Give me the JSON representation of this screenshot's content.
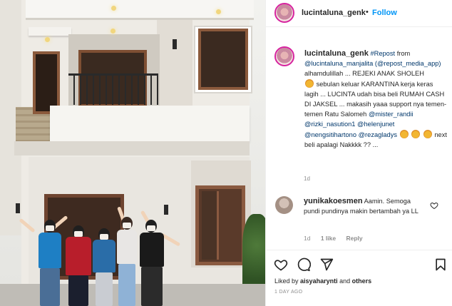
{
  "header": {
    "username": "lucintaluna_genk",
    "separator": "•",
    "follow_label": "Follow"
  },
  "caption": {
    "username": "lucintaluna_genk",
    "repost_tag": "#Repost",
    "from": "from",
    "source_mention": "@lucintaluna_manjalita",
    "app_mention": "(@repost_media_app)",
    "line1": "alhamdulillah ... REJEKI ANAK SHOLEH",
    "line2a": "sebulan keluar KARANTINA kerja keras lagih ... LUCINTA udah bisa beli RUMAH CASH DI JAKSEL ... makasih yaaa support nya temen-temen Ratu Salomeh",
    "mention1": "@mister_randii",
    "mention2": "@rizki_nasution1",
    "mention3": "@helenjunet",
    "mention4": "@nengsitihartono",
    "mention5": "@rezagladys",
    "line_end": "next beli apalagi Nakkkk ?? ...",
    "time": "1d"
  },
  "comment": {
    "username": "yunikakoesmen",
    "text": "Aamin. Semoga pundi pundinya makin bertambah ya LL",
    "time": "1d",
    "likes": "1 like",
    "reply": "Reply",
    "heart_icon": "heart-outline-icon"
  },
  "actions": {
    "icons": [
      "heart-icon",
      "comment-icon",
      "share-icon",
      "bookmark-icon"
    ]
  },
  "likes": {
    "prefix": "Liked by",
    "user": "aisyaharynti",
    "and": "and",
    "others": "others"
  },
  "posted": "1 DAY AGO",
  "colors": {
    "link": "#00376b",
    "follow": "#0095f6",
    "muted": "#8e8e8e"
  }
}
